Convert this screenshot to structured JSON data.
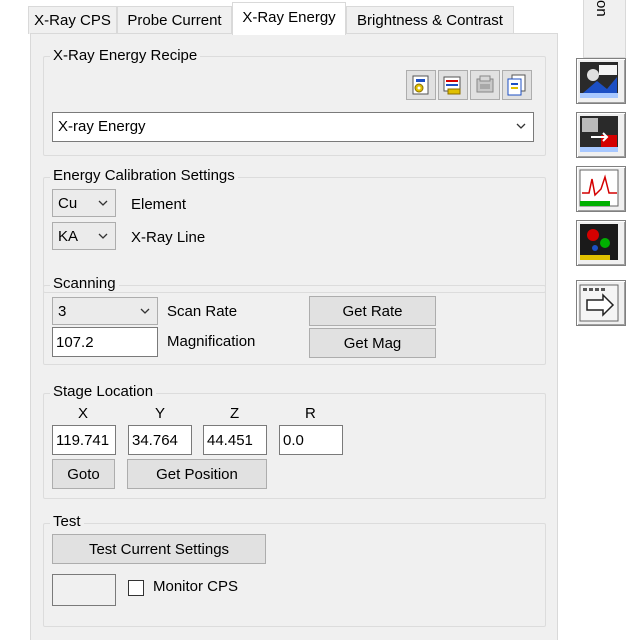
{
  "tabs": [
    {
      "label": "X-Ray CPS"
    },
    {
      "label": "Probe Current"
    },
    {
      "label": "X-Ray Energy"
    },
    {
      "label": "Brightness & Contrast"
    }
  ],
  "active_tab": "X-Ray Energy",
  "side_tab_fragment": "on",
  "recipe": {
    "title": "X-Ray Energy Recipe",
    "selected": "X-ray Energy",
    "icons": [
      "load-recipe-icon",
      "save-recipe-icon",
      "delete-recipe-icon",
      "copy-recipe-icon"
    ]
  },
  "calibration": {
    "title": "Energy Calibration Settings",
    "element_value": "Cu",
    "element_label": "Element",
    "line_value": "KA",
    "line_label": "X-Ray Line"
  },
  "scanning": {
    "title": "Scanning",
    "scan_rate_value": "3",
    "scan_rate_label": "Scan Rate",
    "get_rate_label": "Get Rate",
    "magnification_value": "107.2",
    "magnification_label": "Magnification",
    "get_mag_label": "Get Mag"
  },
  "stage": {
    "title": "Stage Location",
    "axes": [
      {
        "name": "X",
        "value": "119.741"
      },
      {
        "name": "Y",
        "value": "34.764"
      },
      {
        "name": "Z",
        "value": "44.451"
      },
      {
        "name": "R",
        "value": "0.0"
      }
    ],
    "goto_label": "Goto",
    "get_position_label": "Get Position"
  },
  "test": {
    "title": "Test",
    "test_button_label": "Test Current Settings",
    "cps_value": "",
    "monitor_label": "Monitor CPS",
    "monitor_checked": false
  },
  "side_toolbar": [
    {
      "icon": "image-acquire-icon"
    },
    {
      "icon": "image-compare-icon"
    },
    {
      "icon": "spectrum-chart-icon"
    },
    {
      "icon": "map-color-icon"
    },
    {
      "icon": "next-arrow-icon"
    }
  ],
  "colors": {
    "panel": "#f0f0f0",
    "button": "#e1e1e1",
    "accent_red": "#d40000",
    "accent_green": "#00b000",
    "accent_yellow": "#e0c000",
    "accent_blue": "#1c4fc4"
  }
}
